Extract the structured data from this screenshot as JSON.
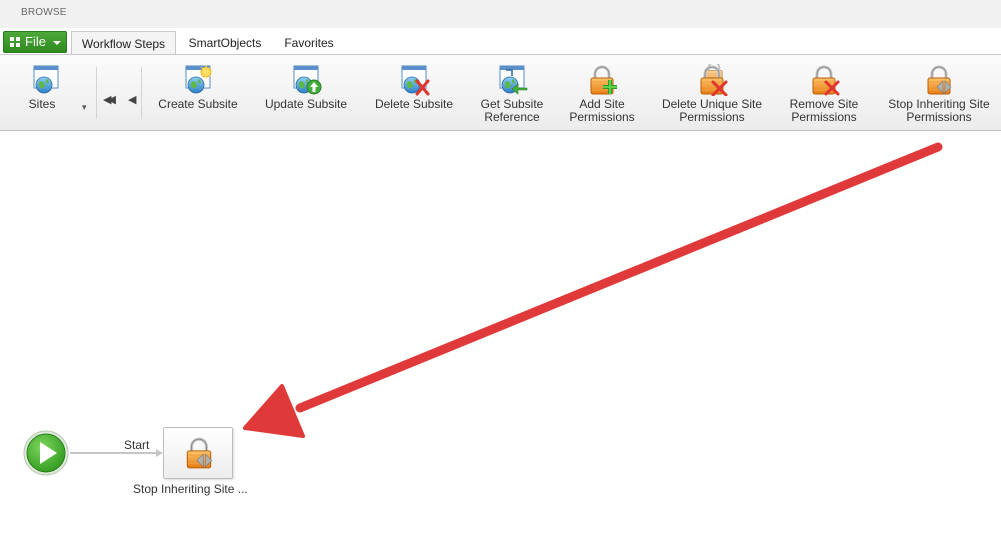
{
  "browse_bar": {
    "label": "BROWSE"
  },
  "tabs": {
    "file": {
      "label": "File",
      "icon": "grid-icon",
      "color": "#3f9a2d"
    },
    "items": [
      {
        "label": "Workflow Steps",
        "active": true
      },
      {
        "label": "SmartObjects",
        "active": false
      },
      {
        "label": "Favorites",
        "active": false
      }
    ]
  },
  "ribbon": {
    "sites": {
      "label": "Sites",
      "icon": "site-globe-icon"
    },
    "nav": {
      "first": "⏴⏴",
      "prev": "⏴"
    },
    "buttons": [
      {
        "line1": "Create Subsite",
        "line2": "",
        "icon": "create-subsite-icon"
      },
      {
        "line1": "Update Subsite",
        "line2": "",
        "icon": "update-subsite-icon"
      },
      {
        "line1": "Delete Subsite",
        "line2": "",
        "icon": "delete-subsite-icon"
      },
      {
        "line1": "Get Subsite",
        "line2": "Reference",
        "icon": "subsite-reference-icon"
      },
      {
        "line1": "Add Site",
        "line2": "Permissions",
        "icon": "add-permissions-lock-icon"
      },
      {
        "line1": "Delete Unique Site",
        "line2": "Permissions",
        "icon": "delete-unique-permissions-lock-icon"
      },
      {
        "line1": "Remove Site",
        "line2": "Permissions",
        "icon": "remove-permissions-lock-icon"
      },
      {
        "line1": "Stop Inheriting Site",
        "line2": "Permissions",
        "icon": "stop-inheriting-lock-icon"
      }
    ]
  },
  "canvas": {
    "start_label": "Start",
    "step_label": "Stop Inheriting Site ...",
    "step_icon": "stop-inheriting-lock-icon",
    "start_color": "#4caf2e",
    "arrow_color": "#e0393a"
  }
}
